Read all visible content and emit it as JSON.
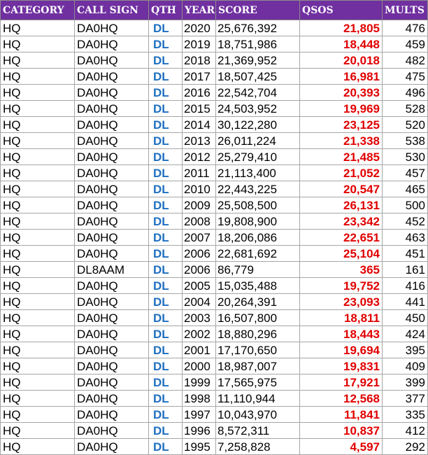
{
  "headers": {
    "category": "CATEGORY",
    "call_sign": "CALL SIGN",
    "qth": "QTH",
    "year": "YEAR",
    "score": "SCORE",
    "qsos": "QSOS",
    "mults": "MULTS"
  },
  "rows": [
    {
      "category": "HQ",
      "call_sign": "DA0HQ",
      "qth": "DL",
      "year": "2020",
      "score": "25,676,392",
      "qsos": "21,805",
      "mults": "476"
    },
    {
      "category": "HQ",
      "call_sign": "DA0HQ",
      "qth": "DL",
      "year": "2019",
      "score": "18,751,986",
      "qsos": "18,448",
      "mults": "459"
    },
    {
      "category": "HQ",
      "call_sign": "DA0HQ",
      "qth": "DL",
      "year": "2018",
      "score": "21,369,952",
      "qsos": "20,018",
      "mults": "482"
    },
    {
      "category": "HQ",
      "call_sign": "DA0HQ",
      "qth": "DL",
      "year": "2017",
      "score": "18,507,425",
      "qsos": "16,981",
      "mults": "475"
    },
    {
      "category": "HQ",
      "call_sign": "DA0HQ",
      "qth": "DL",
      "year": "2016",
      "score": "22,542,704",
      "qsos": "20,393",
      "mults": "496"
    },
    {
      "category": "HQ",
      "call_sign": "DA0HQ",
      "qth": "DL",
      "year": "2015",
      "score": "24,503,952",
      "qsos": "19,969",
      "mults": "528"
    },
    {
      "category": "HQ",
      "call_sign": "DA0HQ",
      "qth": "DL",
      "year": "2014",
      "score": "30,122,280",
      "qsos": "23,125",
      "mults": "520"
    },
    {
      "category": "HQ",
      "call_sign": "DA0HQ",
      "qth": "DL",
      "year": "2013",
      "score": "26,011,224",
      "qsos": "21,338",
      "mults": "538"
    },
    {
      "category": "HQ",
      "call_sign": "DA0HQ",
      "qth": "DL",
      "year": "2012",
      "score": "25,279,410",
      "qsos": "21,485",
      "mults": "530"
    },
    {
      "category": "HQ",
      "call_sign": "DA0HQ",
      "qth": "DL",
      "year": "2011",
      "score": "21,113,400",
      "qsos": "21,052",
      "mults": "457"
    },
    {
      "category": "HQ",
      "call_sign": "DA0HQ",
      "qth": "DL",
      "year": "2010",
      "score": "22,443,225",
      "qsos": "20,547",
      "mults": "465"
    },
    {
      "category": "HQ",
      "call_sign": "DA0HQ",
      "qth": "DL",
      "year": "2009",
      "score": "25,508,500",
      "qsos": "26,131",
      "mults": "500"
    },
    {
      "category": "HQ",
      "call_sign": "DA0HQ",
      "qth": "DL",
      "year": "2008",
      "score": "19,808,900",
      "qsos": "23,342",
      "mults": "452"
    },
    {
      "category": "HQ",
      "call_sign": "DA0HQ",
      "qth": "DL",
      "year": "2007",
      "score": "18,206,086",
      "qsos": "22,651",
      "mults": "463"
    },
    {
      "category": "HQ",
      "call_sign": "DA0HQ",
      "qth": "DL",
      "year": "2006",
      "score": "22,681,692",
      "qsos": "25,104",
      "mults": "451"
    },
    {
      "category": "HQ",
      "call_sign": "DL8AAM",
      "qth": "DL",
      "year": "2006",
      "score": "86,779",
      "qsos": "365",
      "mults": "161"
    },
    {
      "category": "HQ",
      "call_sign": "DA0HQ",
      "qth": "DL",
      "year": "2005",
      "score": "15,035,488",
      "qsos": "19,752",
      "mults": "416"
    },
    {
      "category": "HQ",
      "call_sign": "DA0HQ",
      "qth": "DL",
      "year": "2004",
      "score": "20,264,391",
      "qsos": "23,093",
      "mults": "441"
    },
    {
      "category": "HQ",
      "call_sign": "DA0HQ",
      "qth": "DL",
      "year": "2003",
      "score": "16,507,800",
      "qsos": "18,811",
      "mults": "450"
    },
    {
      "category": "HQ",
      "call_sign": "DA0HQ",
      "qth": "DL",
      "year": "2002",
      "score": "18,880,296",
      "qsos": "18,443",
      "mults": "424"
    },
    {
      "category": "HQ",
      "call_sign": "DA0HQ",
      "qth": "DL",
      "year": "2001",
      "score": "17,170,650",
      "qsos": "19,694",
      "mults": "395"
    },
    {
      "category": "HQ",
      "call_sign": "DA0HQ",
      "qth": "DL",
      "year": "2000",
      "score": "18,987,007",
      "qsos": "19,831",
      "mults": "409"
    },
    {
      "category": "HQ",
      "call_sign": "DA0HQ",
      "qth": "DL",
      "year": "1999",
      "score": "17,565,975",
      "qsos": "17,921",
      "mults": "399"
    },
    {
      "category": "HQ",
      "call_sign": "DA0HQ",
      "qth": "DL",
      "year": "1998",
      "score": "11,110,944",
      "qsos": "12,568",
      "mults": "377"
    },
    {
      "category": "HQ",
      "call_sign": "DA0HQ",
      "qth": "DL",
      "year": "1997",
      "score": "10,043,970",
      "qsos": "11,841",
      "mults": "335"
    },
    {
      "category": "HQ",
      "call_sign": "DA0HQ",
      "qth": "DL",
      "year": "1996",
      "score": "8,572,311",
      "qsos": "10,837",
      "mults": "412"
    },
    {
      "category": "HQ",
      "call_sign": "DA0HQ",
      "qth": "DL",
      "year": "1995",
      "score": "7,258,828",
      "qsos": "4,597",
      "mults": "292"
    }
  ],
  "colors": {
    "header_bg": "#7030a0",
    "header_text": "#ffffff",
    "qth_text": "#1f6fc0",
    "qsos_text": "#e00000",
    "grid_line": "#a6a6a6"
  }
}
